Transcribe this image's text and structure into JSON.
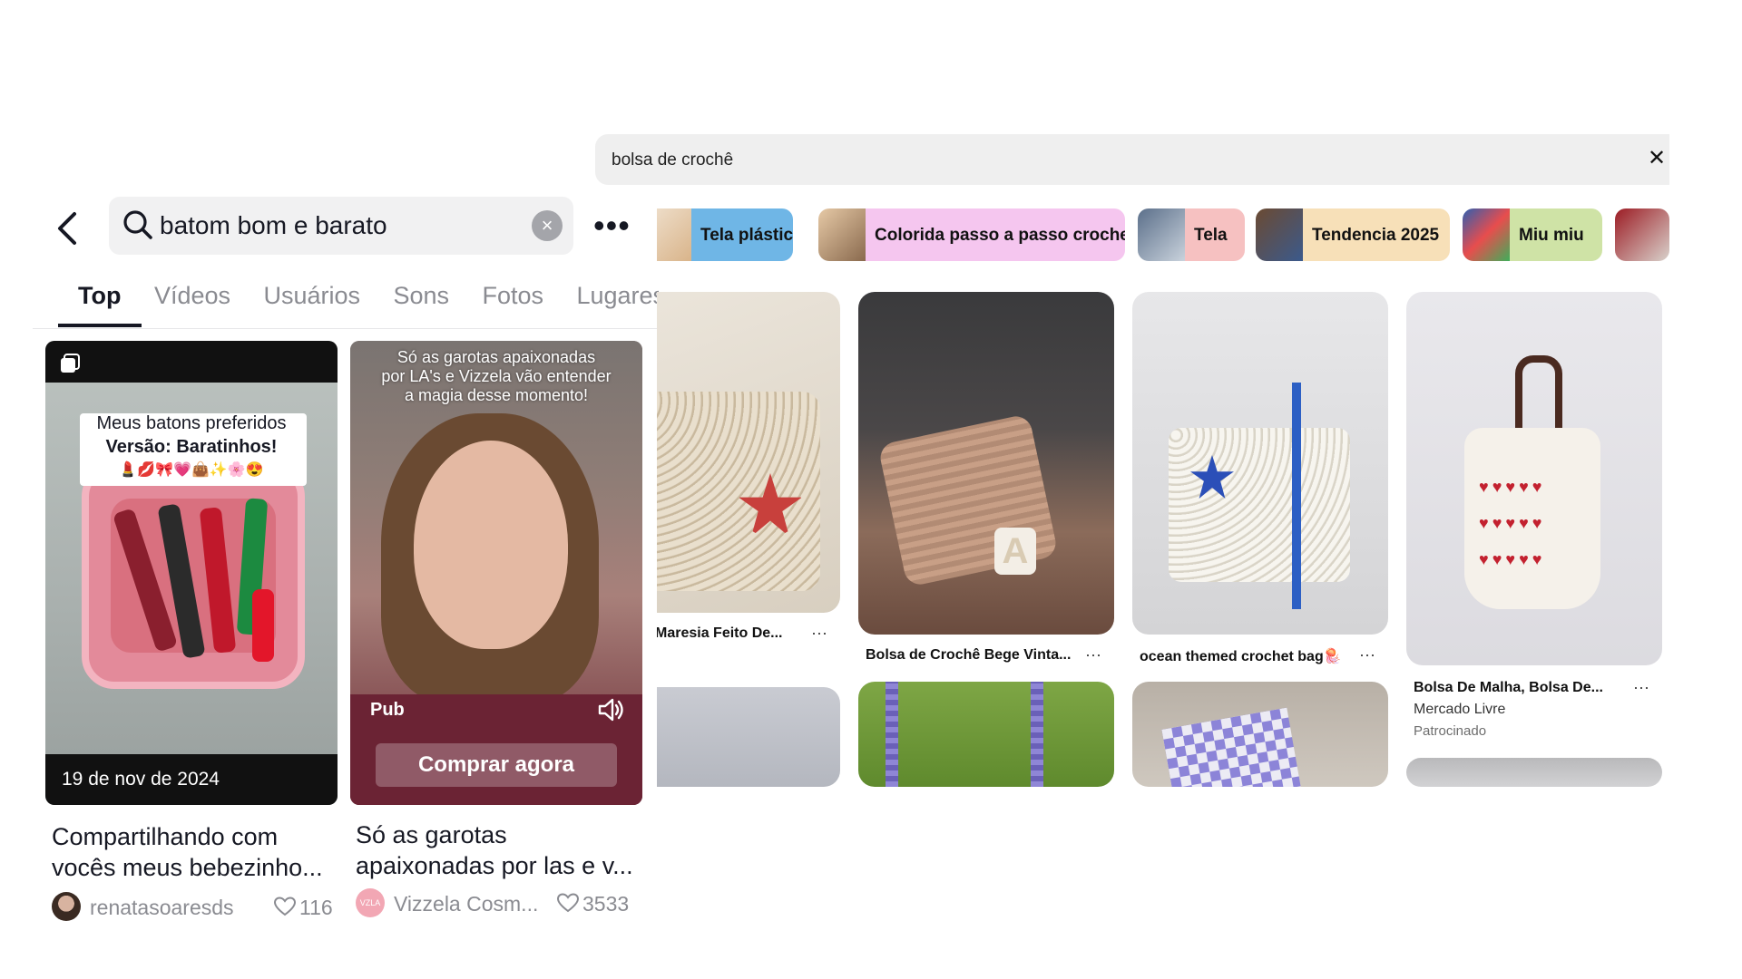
{
  "tiktok": {
    "search": {
      "query": "batom bom e barato"
    },
    "tabs": [
      "Top",
      "Vídeos",
      "Usuários",
      "Sons",
      "Fotos",
      "Lugares"
    ],
    "cards": [
      {
        "overlay_line1": "Meus batons preferidos",
        "overlay_line2": "Versão: Baratinhos!",
        "overlay_line3": "💄💋🎀💗👜✨🌸😍",
        "date": "19 de nov de 2024",
        "title_line1": "Compartilhando com",
        "title_line2": "vocês meus bebezinho...",
        "author": "renatasoaresds",
        "likes": "116"
      },
      {
        "overlay_line1": "Só as garotas apaixonadas",
        "overlay_line2": "por LA's e Vizzela vão entender",
        "overlay_line3": "a magia desse momento!",
        "badge": "Pub",
        "cta": "Comprar agora",
        "title_line1": "Só as garotas",
        "title_line2": "apaixonadas por las e v...",
        "author": "Vizzela Cosm...",
        "avatar_text": "VZLA",
        "likes": "3533"
      }
    ]
  },
  "pinterest": {
    "search": {
      "query": "bolsa de crochê"
    },
    "chips": [
      {
        "label": "Tela plástica",
        "color": "#6fb6e6"
      },
      {
        "label": "Colorida passo a passo croche",
        "color": "#f5c6ef"
      },
      {
        "label": "Tela",
        "color": "#f6c1c1"
      },
      {
        "label": "Tendencia 2025",
        "color": "#f7e0b8"
      },
      {
        "label": "Miu miu",
        "color": "#cfe3a6"
      }
    ],
    "pins": [
      {
        "label": "Maresia Feito De..."
      },
      {
        "label": "Bolsa de Crochê Bege Vinta..."
      },
      {
        "label": "ocean themed crochet bag🪼"
      },
      {
        "label": "Bolsa De Malha, Bolsa De...",
        "source": "Mercado Livre",
        "sponsored": "Patrocinado"
      }
    ],
    "more_label": "···"
  }
}
